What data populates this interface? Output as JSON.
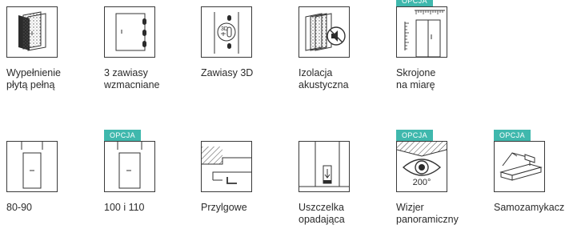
{
  "badge_color": "#3fb8ad",
  "features": [
    {
      "id": "wypelnienie",
      "icon": "solid-core-door-icon",
      "badge": "",
      "label": [
        "Wypełnienie",
        "płytą pełną"
      ]
    },
    {
      "id": "zawiasy",
      "icon": "three-hinges-icon",
      "badge": "",
      "label": [
        "3 zawiasy",
        "wzmacniane"
      ]
    },
    {
      "id": "zawiasy3d",
      "icon": "3d-hinge-icon",
      "badge": "",
      "label": [
        "Zawiasy 3D"
      ]
    },
    {
      "id": "izolacja",
      "icon": "acoustic-insulation-icon",
      "badge": "",
      "label": [
        "Izolacja",
        "akustyczna"
      ]
    },
    {
      "id": "skrojone",
      "icon": "made-to-measure-icon",
      "badge": "OPCJA",
      "label": [
        "Skrojone",
        "na miarę"
      ]
    },
    {
      "id": "80-90",
      "icon": "door-80-90-icon",
      "badge": "",
      "label": [
        "80-90"
      ]
    },
    {
      "id": "100-110",
      "icon": "door-100-110-icon",
      "badge": "OPCJA",
      "label": [
        "100 i 110"
      ]
    },
    {
      "id": "przylgowe",
      "icon": "rebated-door-icon",
      "badge": "",
      "label": [
        "Przylgowe"
      ]
    },
    {
      "id": "uszczelka",
      "icon": "drop-seal-icon",
      "badge": "",
      "label": [
        "Uszczelka",
        "opadająca"
      ]
    },
    {
      "id": "wizjer",
      "icon": "peephole-eye-icon",
      "badge": "OPCJA",
      "label": [
        "Wizjer",
        "panoramiczny"
      ],
      "icon_text": "200°"
    },
    {
      "id": "samozamykacz",
      "icon": "door-closer-icon",
      "badge": "OPCJA",
      "label": [
        "Samozamykacz"
      ]
    }
  ]
}
